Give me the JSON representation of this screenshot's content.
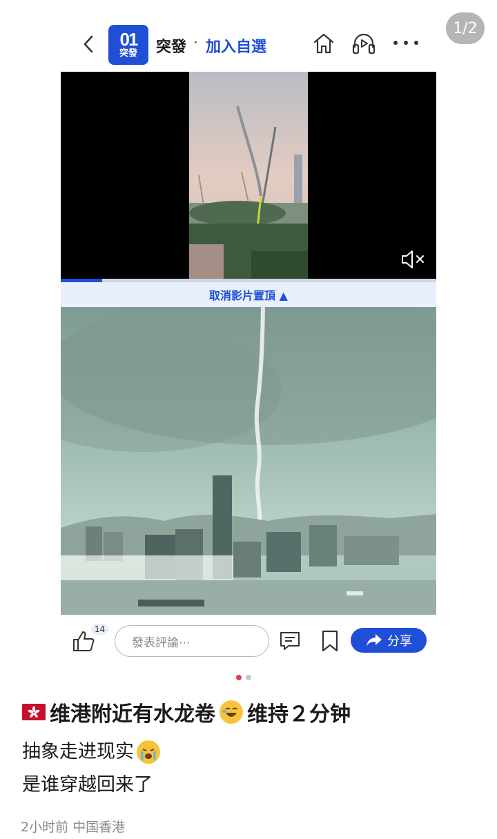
{
  "page_counter": "1/2",
  "header": {
    "logo_number": "01",
    "logo_sub": "突發",
    "brand_name": "突發",
    "separator": "·",
    "join_link": "加入自選"
  },
  "video": {
    "unpin_label": "取消影片置頂 ▲",
    "progress": 0.11
  },
  "actions": {
    "like_count": "14",
    "comment_placeholder": "發表評論⋯",
    "share_label": "分享"
  },
  "pager": {
    "total": 2,
    "active": 1
  },
  "post": {
    "title": "维港附近有水龙卷",
    "title_suffix": "维持２分钟",
    "body_line1": "抽象走进现实",
    "body_line2": "是谁穿越回来了",
    "meta": "2小时前 中国香港"
  },
  "colors": {
    "brand_blue": "#1f4fd6",
    "pager_active": "#e0404a",
    "pager_inactive": "#c8c8c8"
  },
  "icons": [
    "back-icon",
    "home-icon",
    "headphones-icon",
    "more-icon",
    "mute-icon",
    "thumbs-up-icon",
    "comment-icon",
    "bookmark-icon",
    "share-arrow-icon",
    "hk-flag-icon",
    "laughing-emoji-icon",
    "crying-emoji-icon"
  ]
}
